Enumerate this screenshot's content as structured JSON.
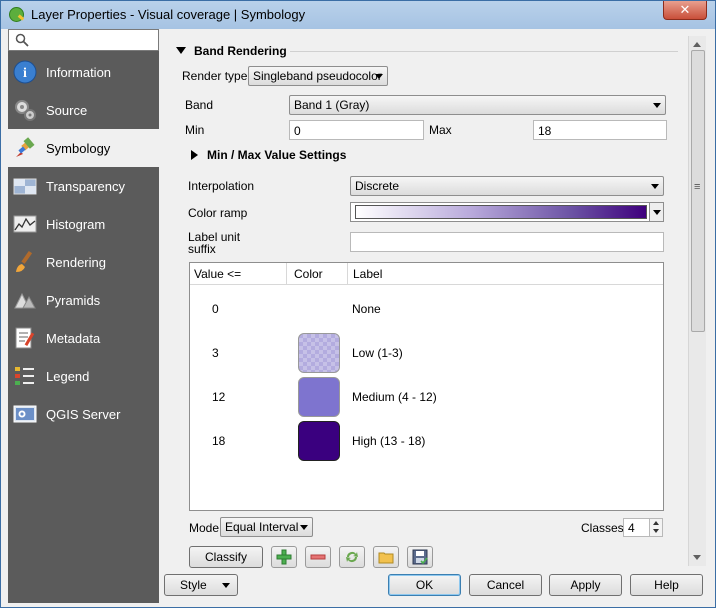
{
  "window": {
    "title": "Layer Properties - Visual coverage | Symbology",
    "close_label": "✕"
  },
  "sidebar": {
    "search_placeholder": "",
    "items": [
      {
        "label": "Information",
        "icon": "information-icon",
        "active": false
      },
      {
        "label": "Source",
        "icon": "source-icon",
        "active": false
      },
      {
        "label": "Symbology",
        "icon": "symbology-icon",
        "active": true
      },
      {
        "label": "Transparency",
        "icon": "transparency-icon",
        "active": false
      },
      {
        "label": "Histogram",
        "icon": "histogram-icon",
        "active": false
      },
      {
        "label": "Rendering",
        "icon": "rendering-icon",
        "active": false
      },
      {
        "label": "Pyramids",
        "icon": "pyramids-icon",
        "active": false
      },
      {
        "label": "Metadata",
        "icon": "metadata-icon",
        "active": false
      },
      {
        "label": "Legend",
        "icon": "legend-icon",
        "active": false
      },
      {
        "label": "QGIS Server",
        "icon": "qgis-server-icon",
        "active": false
      }
    ]
  },
  "band_rendering": {
    "section_title": "Band Rendering",
    "render_type_label": "Render type",
    "render_type_value": "Singleband pseudocolor",
    "band_label": "Band",
    "band_value": "Band 1 (Gray)",
    "min_label": "Min",
    "min_value": "0",
    "max_label": "Max",
    "max_value": "18",
    "minmax_section": "Min / Max Value Settings",
    "interpolation_label": "Interpolation",
    "interpolation_value": "Discrete",
    "color_ramp_label": "Color ramp",
    "label_unit_label_line1": "Label unit",
    "label_unit_label_line2": "suffix",
    "label_unit_value": ""
  },
  "table": {
    "headers": [
      "Value <=",
      "Color",
      "Label"
    ],
    "rows": [
      {
        "value": "0",
        "color": "transparent",
        "label": "None"
      },
      {
        "value": "3",
        "color": "#b3acdf",
        "label": "Low (1-3)"
      },
      {
        "value": "12",
        "color": "#7e74cf",
        "label": "Medium (4 - 12)"
      },
      {
        "value": "18",
        "color": "#3a007f",
        "label": "High (13 - 18)"
      }
    ]
  },
  "mode": {
    "label": "Mode",
    "value": "Equal Interval"
  },
  "classes": {
    "label": "Classes",
    "value": "4"
  },
  "classify_label": "Classify",
  "footer": {
    "style_label": "Style",
    "ok_label": "OK",
    "cancel_label": "Cancel",
    "apply_label": "Apply",
    "help_label": "Help"
  }
}
